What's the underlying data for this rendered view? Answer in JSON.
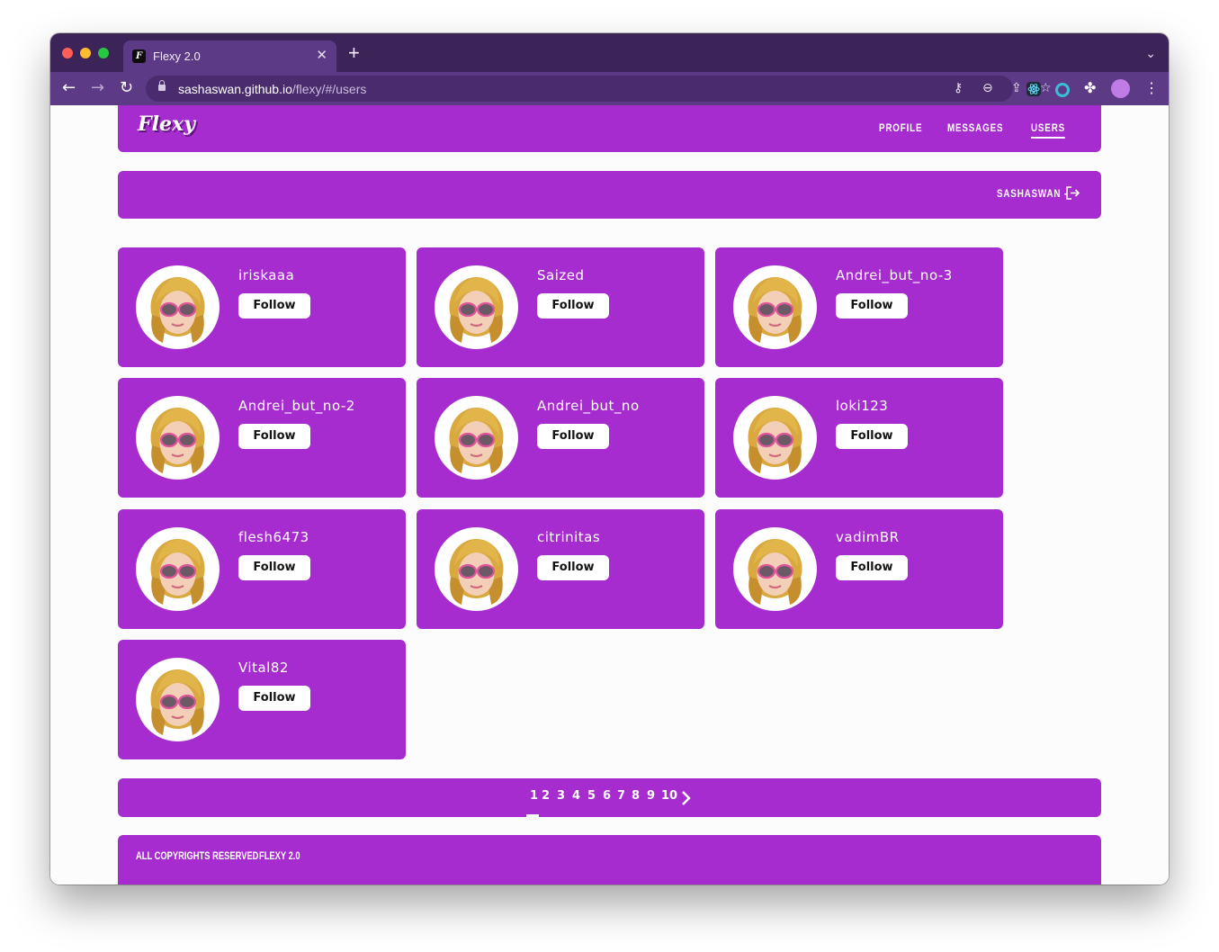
{
  "browser": {
    "tab_title": "Flexy 2.0",
    "favicon_letter": "F",
    "url_host": "sashaswan.github.io",
    "url_path": "/flexy/#/users"
  },
  "header": {
    "logo": "Flexy",
    "nav": [
      "PROFILE",
      "MESSAGES",
      "USERS"
    ],
    "active_nav": "USERS"
  },
  "userbar": {
    "username": "SASHASWAN -"
  },
  "users": [
    {
      "name": "iriskaaa",
      "button": "Follow"
    },
    {
      "name": "Saized",
      "button": "Follow"
    },
    {
      "name": "Andrei_but_no-3",
      "button": "Follow"
    },
    {
      "name": "Andrei_but_no-2",
      "button": "Follow"
    },
    {
      "name": "Andrei_but_no",
      "button": "Follow"
    },
    {
      "name": "loki123",
      "button": "Follow"
    },
    {
      "name": "flesh6473",
      "button": "Follow"
    },
    {
      "name": "citrinitas",
      "button": "Follow"
    },
    {
      "name": "vadimBR",
      "button": "Follow"
    },
    {
      "name": "Vital82",
      "button": "Follow"
    }
  ],
  "pagination": {
    "pages": [
      "1",
      "2",
      "3",
      "4",
      "5",
      "6",
      "7",
      "8",
      "9",
      "10"
    ],
    "current": "1"
  },
  "footer": {
    "copyright": "ALL COPYRIGHTS RESERVED",
    "version": "FLEXY 2.0"
  },
  "colors": {
    "brand_purple": "#a72ccf",
    "browser_frame": "#3d2458",
    "browser_toolbar": "#5d3a86"
  }
}
